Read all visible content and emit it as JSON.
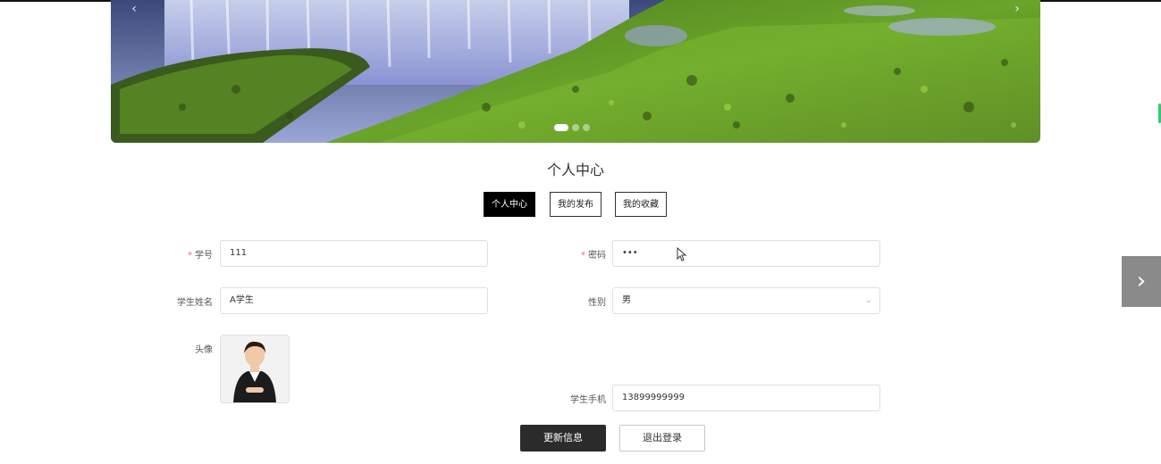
{
  "carousel": {
    "prev_icon": "‹",
    "next_icon": "›",
    "slide_count": 3,
    "active_slide": 1
  },
  "page_title": "个人中心",
  "tabs": [
    {
      "label": "个人中心",
      "active": true
    },
    {
      "label": "我的发布",
      "active": false
    },
    {
      "label": "我的收藏",
      "active": false
    }
  ],
  "form": {
    "student_id": {
      "label": "学号",
      "required": true,
      "value": "111"
    },
    "password": {
      "label": "密码",
      "required": true,
      "value": "•••"
    },
    "student_name": {
      "label": "学生姓名",
      "value": "A学生"
    },
    "gender": {
      "label": "性别",
      "value": "男"
    },
    "avatar": {
      "label": "头像"
    },
    "phone": {
      "label": "学生手机",
      "value": "13899999999"
    }
  },
  "buttons": {
    "update": "更新信息",
    "logout": "退出登录"
  },
  "side_next_icon": "›",
  "colors": {
    "primary_button": "#2b2b2b",
    "active_tab": "#000000",
    "required_star": "#f56c6c"
  }
}
